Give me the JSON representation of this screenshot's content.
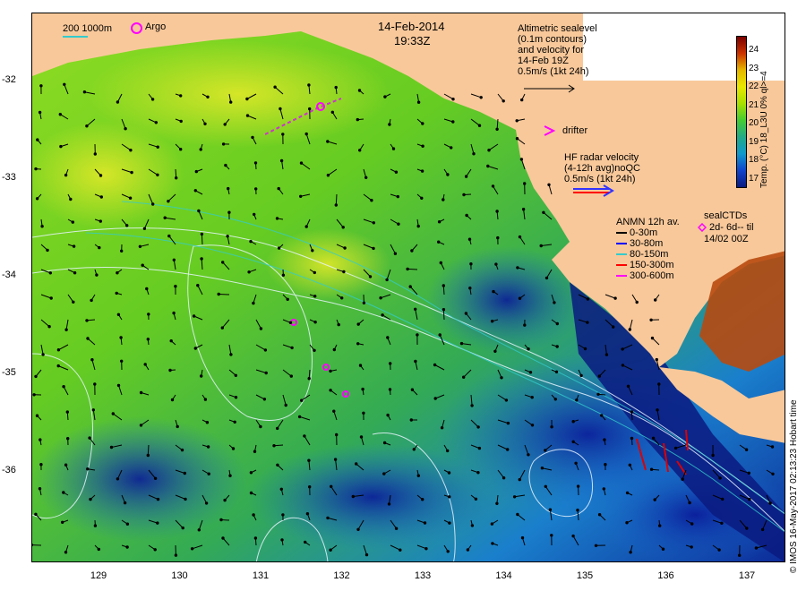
{
  "map": {
    "date": "14-Feb-2014",
    "time": "19:33Z",
    "bathy_legend": "200  1000m",
    "argo_label": "Argo",
    "altimetry_note": [
      "Altimetric sealevel",
      "(0.1m contours)",
      "and velocity for",
      "14-Feb 19Z",
      "0.5m/s (1kt 24h)"
    ],
    "drifter_label": "drifter",
    "hf_radar_note": [
      "HF radar velocity",
      "(4-12h avg)noQC",
      "0.5m/s (1kt 24h)"
    ],
    "anmn_title": "ANMN 12h av.",
    "anmn_items": [
      {
        "label": "0-30m",
        "color": "#000000"
      },
      {
        "label": "30-80m",
        "color": "#0000ff"
      },
      {
        "label": "80-150m",
        "color": "#33cccc"
      },
      {
        "label": "150-300m",
        "color": "#ff0000"
      },
      {
        "label": "300-600m",
        "color": "#ff00ff"
      }
    ],
    "sealctd_note": [
      "sealCTDs",
      "2d- 6d-- til",
      "14/02 00Z"
    ],
    "colorbar": {
      "title": "Temp. (°C) 18_L3U 0% ql>=4",
      "ticks": [
        "24",
        "23",
        "22",
        "21",
        "20",
        "19",
        "18",
        "17"
      ],
      "colors": [
        "#7a0000",
        "#cc3300",
        "#e6b800",
        "#e8e800",
        "#a8e000",
        "#44cc33",
        "#22aa88",
        "#1199cc",
        "#1144cc",
        "#0a1a80"
      ]
    },
    "y_ticks": [
      "-32",
      "-33",
      "-34",
      "-35",
      "-36"
    ],
    "x_ticks": [
      "129",
      "130",
      "131",
      "132",
      "133",
      "134",
      "135",
      "136",
      "137"
    ],
    "credit": "© IMOS 16-May-2017 02:13:23 Hobart time",
    "colors": {
      "land": "#f8c89a",
      "cool": "#1a5fd1",
      "warm": "#c8e000",
      "mid": "#44cc22"
    }
  }
}
